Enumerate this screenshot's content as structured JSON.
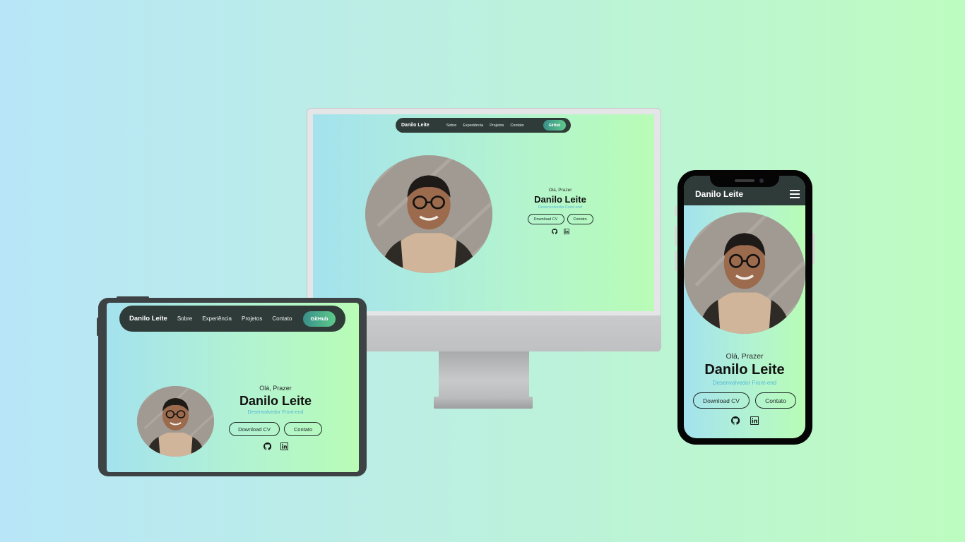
{
  "site": {
    "brand": "Danilo Leite",
    "nav": [
      "Sobre",
      "Experiência",
      "Projetos",
      "Contato"
    ],
    "github_button": "GitHub",
    "greeting": "Olá, Prazer",
    "name": "Danilo Leite",
    "role": "Desenvolvedor Front-end",
    "download_cv": "Download CV",
    "contact": "Contato"
  },
  "icons": {
    "github": "github-icon",
    "linkedin": "linkedin-icon",
    "menu": "hamburger-menu-icon"
  },
  "colors": {
    "background_start": "#b8e6f8",
    "background_end": "#bdfcc0",
    "nav_bg": "#2f3b38",
    "role_text": "#55b8d4"
  }
}
